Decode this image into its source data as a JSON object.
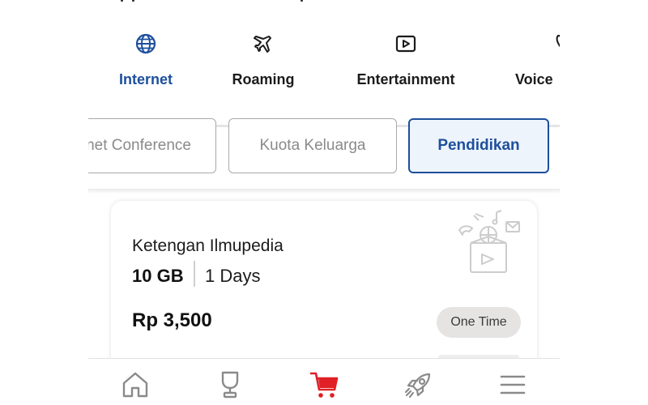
{
  "tabs": [
    {
      "label": "Internet",
      "icon": "globe-icon",
      "active": true
    },
    {
      "label": "Roaming",
      "icon": "airplane-icon",
      "active": false
    },
    {
      "label": "Entertainment",
      "icon": "play-icon",
      "active": false
    },
    {
      "label": "Voice",
      "icon": "phone-icon",
      "active": false
    }
  ],
  "chips": [
    {
      "label": "Internet Conference",
      "active": false
    },
    {
      "label": "Kuota Keluarga",
      "active": false
    },
    {
      "label": "Pendidikan",
      "active": true
    }
  ],
  "package": {
    "name": "Ketengan Ilmupedia",
    "quota": "10 GB",
    "duration": "1 Days",
    "price": "Rp 3,500",
    "badge": "One Time"
  },
  "bottom_nav": [
    {
      "icon": "home-icon"
    },
    {
      "icon": "trophy-icon"
    },
    {
      "icon": "cart-icon",
      "active": true
    },
    {
      "icon": "rocket-icon"
    },
    {
      "icon": "menu-icon"
    }
  ],
  "colors": {
    "primary": "#1d4f9c",
    "active_nav": "#e01f26",
    "chip_active_bg": "#eef4fc",
    "badge_bg": "#e6e4e3"
  }
}
